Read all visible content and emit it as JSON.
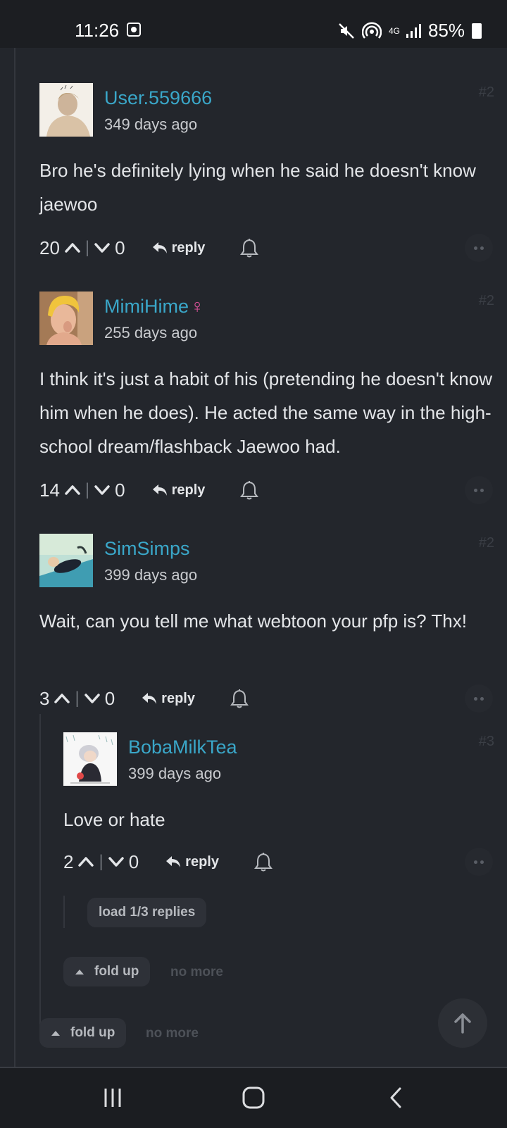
{
  "status_bar": {
    "time": "11:26",
    "network": "4G",
    "battery": "85%"
  },
  "comments": [
    {
      "username": "User.559666",
      "date": "349 days ago",
      "floor": "#2",
      "text": "Bro he's definitely lying when he said he doesn't know jaewoo",
      "upvotes": "20",
      "downvotes": "0",
      "reply_label": "reply"
    },
    {
      "username": "MimiHime",
      "gender_symbol": "♀",
      "date": "255 days ago",
      "floor": "#2",
      "text": "I think it's just a habit of his (pretending he doesn't know him when he does). He acted the same way in the high-school dream/flashback Jaewoo had.",
      "upvotes": "14",
      "downvotes": "0",
      "reply_label": "reply"
    },
    {
      "username": "SimSimps",
      "date": "399 days ago",
      "floor": "#2",
      "text": "Wait, can you tell me what webtoon your pfp is? Thx!",
      "upvotes": "3",
      "downvotes": "0",
      "reply_label": "reply"
    },
    {
      "username": "BobaMilkTea",
      "date": "399 days ago",
      "floor": "#3",
      "text": "Love or hate",
      "upvotes": "2",
      "downvotes": "0",
      "reply_label": "reply"
    }
  ],
  "load_replies_label": "load 1/3 replies",
  "fold_up_label": "fold up",
  "no_more_label": "no more",
  "colors": {
    "background": "#23262c",
    "username": "#3aa7c9",
    "female_symbol": "#e0529c"
  }
}
